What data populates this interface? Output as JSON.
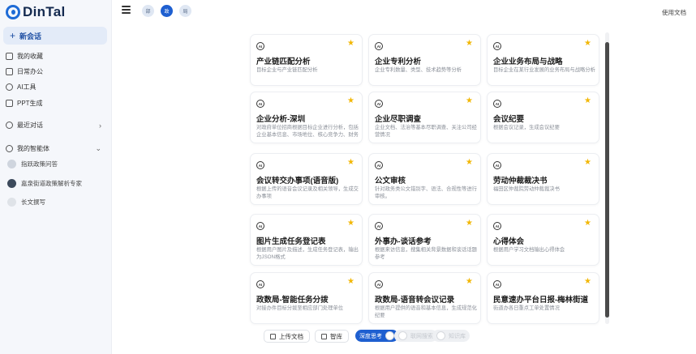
{
  "app": {
    "name": "DinTal"
  },
  "sidebar": {
    "new_chat": "新会话",
    "nav": [
      {
        "label": "我的收藏",
        "icon": "bookmark-icon"
      },
      {
        "label": "日常办公",
        "icon": "briefcase-icon"
      },
      {
        "label": "AI工具",
        "icon": "ai-tool-icon"
      },
      {
        "label": "PPT生成",
        "icon": "presentation-icon"
      }
    ],
    "recent_label": "最近对话",
    "agents_label": "我的智能体",
    "agents": [
      {
        "label": "指跃政策问答"
      },
      {
        "label": "嘉泉街道政策解析专家"
      },
      {
        "label": "长文撰写"
      }
    ]
  },
  "topbar": {
    "pills": [
      "部",
      "政",
      "局"
    ],
    "docs_link": "使用文档"
  },
  "cards": [
    {
      "title": "产业链匹配分析",
      "desc": "目标企业与产业链匹配分析"
    },
    {
      "title": "企业专利分析",
      "desc": "企业专利数量、类型、技术趋势等分析"
    },
    {
      "title": "企业业务布局与战略",
      "desc": "目标企业在某行业发展的业务布局与战略分析"
    },
    {
      "title": "企业分析-深圳",
      "desc": "对政府单位招商根据目标企业进行分析，包括企业基本信息、市场地位、核心竞争力、财务分析、企业风险等"
    },
    {
      "title": "企业尽职调查",
      "desc": "企业文档、法治等基本尽职调查、关注公司经营情况"
    },
    {
      "title": "会议纪要",
      "desc": "根据会议记录，生成会议纪要"
    },
    {
      "title": "会议转交办事项(语音版)",
      "desc": "根据上传的语音会议记录及相关领导，生成交办事项"
    },
    {
      "title": "公文审核",
      "desc": "针对政务类公文错别字、语法、合规性等进行审核。"
    },
    {
      "title": "劳动仲裁裁决书",
      "desc": "福田区仲裁院劳动仲裁裁决书"
    },
    {
      "title": "图片生成任务登记表",
      "desc": "根据用户图片及描述，生成任务登记表，输出为JSON格式"
    },
    {
      "title": "外事办-谈话参考",
      "desc": "根据来访信息，搜集相关背景数据和谈话话题参考"
    },
    {
      "title": "心得体会",
      "desc": "根据用户学习文档输出心得体会"
    },
    {
      "title": "政数局-智能任务分拨",
      "desc": "对接办件目标分拨至相应部门处理单位"
    },
    {
      "title": "政数局-语音转会议记录",
      "desc": "根据用户提供的语音和基本信息，生成规范化纪要"
    },
    {
      "title": "民意速办平台日报-梅林街道",
      "desc": "街道办各日重点工单处置情况"
    }
  ],
  "toolbar": {
    "upload": "上传文档",
    "library": "智库",
    "deep_think": "深度思考",
    "toggle_b": "联网搜索",
    "toggle_c": "知识库"
  }
}
